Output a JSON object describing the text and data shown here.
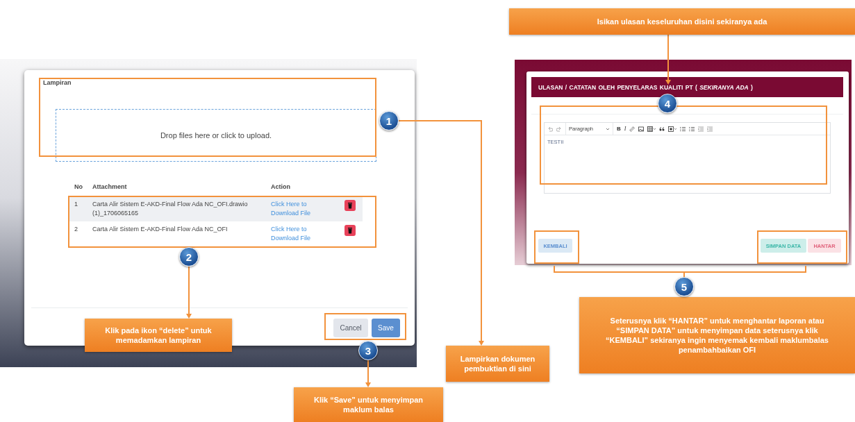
{
  "upload_dialog": {
    "label": "Lampiran",
    "dropzone_text": "Drop files here or click to upload.",
    "table": {
      "columns": [
        "No",
        "Attachment",
        "Action"
      ],
      "rows": [
        {
          "no": "1",
          "attachment": "Carta Alir Sistem E-AKD-Final Flow Ada NC_OFI.drawio (1)_1706065165",
          "action": "Click Here to Download File",
          "highlighted": true
        },
        {
          "no": "2",
          "attachment": "Carta Alir Sistem E-AKD-Final Flow Ada NC_OFI",
          "action": "Click Here to Download File",
          "highlighted": false
        }
      ]
    },
    "buttons": [
      {
        "label": "Cancel",
        "kind": "secondary"
      },
      {
        "label": "Save",
        "kind": "primary"
      }
    ]
  },
  "review_form": {
    "heading": "ULASAN / CATATAN OLEH PENYELARAS KUALITI PT ( *SEKIRANYA ADA* )",
    "toolbar": {
      "block_format": "Paragraph",
      "bold_label": "B",
      "italic_label": "I"
    },
    "editor_text": "TESTII",
    "buttons": [
      {
        "label": "KEMBALI",
        "kind": "info"
      },
      {
        "label": "SIMPAN DATA",
        "kind": "success"
      },
      {
        "label": "HANTAR",
        "kind": "danger"
      }
    ]
  },
  "steps": [
    {
      "number": "1",
      "callout": "Lampirkan dokumen pembuktian di sini"
    },
    {
      "number": "2",
      "callout": "Klik pada ikon “delete” untuk memadamkan lampiran"
    },
    {
      "number": "3",
      "callout": "Klik “Save” untuk menyimpan maklum balas"
    },
    {
      "number": "4",
      "callout": "Isikan ulasan keseluruhan disini sekiranya ada"
    },
    {
      "number": "5",
      "callout": "Seterusnya klik “HANTAR” untuk menghantar laporan atau “SIMPAN DATA” untuk menyimpan data seterusnya klik “KEMBALI” sekiranya ingin menyemak kembali maklumbalas penambahbaikan OFI"
    }
  ]
}
